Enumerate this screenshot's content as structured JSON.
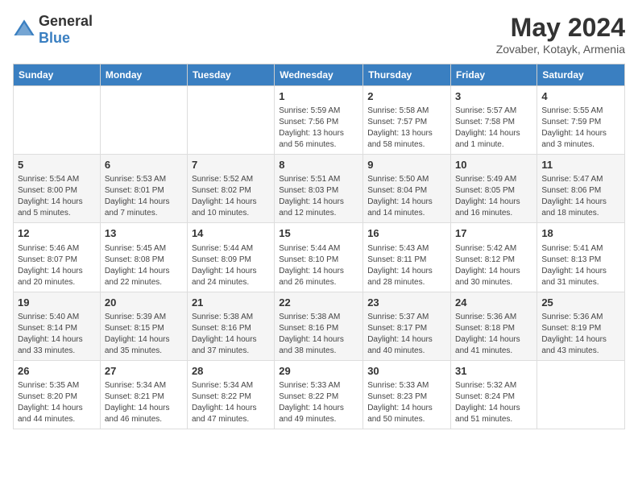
{
  "logo": {
    "general": "General",
    "blue": "Blue"
  },
  "title": {
    "month": "May 2024",
    "location": "Zovaber, Kotayk, Armenia"
  },
  "days_of_week": [
    "Sunday",
    "Monday",
    "Tuesday",
    "Wednesday",
    "Thursday",
    "Friday",
    "Saturday"
  ],
  "weeks": [
    [
      {
        "day": "",
        "info": ""
      },
      {
        "day": "",
        "info": ""
      },
      {
        "day": "",
        "info": ""
      },
      {
        "day": "1",
        "info": "Sunrise: 5:59 AM\nSunset: 7:56 PM\nDaylight: 13 hours and 56 minutes."
      },
      {
        "day": "2",
        "info": "Sunrise: 5:58 AM\nSunset: 7:57 PM\nDaylight: 13 hours and 58 minutes."
      },
      {
        "day": "3",
        "info": "Sunrise: 5:57 AM\nSunset: 7:58 PM\nDaylight: 14 hours and 1 minute."
      },
      {
        "day": "4",
        "info": "Sunrise: 5:55 AM\nSunset: 7:59 PM\nDaylight: 14 hours and 3 minutes."
      }
    ],
    [
      {
        "day": "5",
        "info": "Sunrise: 5:54 AM\nSunset: 8:00 PM\nDaylight: 14 hours and 5 minutes."
      },
      {
        "day": "6",
        "info": "Sunrise: 5:53 AM\nSunset: 8:01 PM\nDaylight: 14 hours and 7 minutes."
      },
      {
        "day": "7",
        "info": "Sunrise: 5:52 AM\nSunset: 8:02 PM\nDaylight: 14 hours and 10 minutes."
      },
      {
        "day": "8",
        "info": "Sunrise: 5:51 AM\nSunset: 8:03 PM\nDaylight: 14 hours and 12 minutes."
      },
      {
        "day": "9",
        "info": "Sunrise: 5:50 AM\nSunset: 8:04 PM\nDaylight: 14 hours and 14 minutes."
      },
      {
        "day": "10",
        "info": "Sunrise: 5:49 AM\nSunset: 8:05 PM\nDaylight: 14 hours and 16 minutes."
      },
      {
        "day": "11",
        "info": "Sunrise: 5:47 AM\nSunset: 8:06 PM\nDaylight: 14 hours and 18 minutes."
      }
    ],
    [
      {
        "day": "12",
        "info": "Sunrise: 5:46 AM\nSunset: 8:07 PM\nDaylight: 14 hours and 20 minutes."
      },
      {
        "day": "13",
        "info": "Sunrise: 5:45 AM\nSunset: 8:08 PM\nDaylight: 14 hours and 22 minutes."
      },
      {
        "day": "14",
        "info": "Sunrise: 5:44 AM\nSunset: 8:09 PM\nDaylight: 14 hours and 24 minutes."
      },
      {
        "day": "15",
        "info": "Sunrise: 5:44 AM\nSunset: 8:10 PM\nDaylight: 14 hours and 26 minutes."
      },
      {
        "day": "16",
        "info": "Sunrise: 5:43 AM\nSunset: 8:11 PM\nDaylight: 14 hours and 28 minutes."
      },
      {
        "day": "17",
        "info": "Sunrise: 5:42 AM\nSunset: 8:12 PM\nDaylight: 14 hours and 30 minutes."
      },
      {
        "day": "18",
        "info": "Sunrise: 5:41 AM\nSunset: 8:13 PM\nDaylight: 14 hours and 31 minutes."
      }
    ],
    [
      {
        "day": "19",
        "info": "Sunrise: 5:40 AM\nSunset: 8:14 PM\nDaylight: 14 hours and 33 minutes."
      },
      {
        "day": "20",
        "info": "Sunrise: 5:39 AM\nSunset: 8:15 PM\nDaylight: 14 hours and 35 minutes."
      },
      {
        "day": "21",
        "info": "Sunrise: 5:38 AM\nSunset: 8:16 PM\nDaylight: 14 hours and 37 minutes."
      },
      {
        "day": "22",
        "info": "Sunrise: 5:38 AM\nSunset: 8:16 PM\nDaylight: 14 hours and 38 minutes."
      },
      {
        "day": "23",
        "info": "Sunrise: 5:37 AM\nSunset: 8:17 PM\nDaylight: 14 hours and 40 minutes."
      },
      {
        "day": "24",
        "info": "Sunrise: 5:36 AM\nSunset: 8:18 PM\nDaylight: 14 hours and 41 minutes."
      },
      {
        "day": "25",
        "info": "Sunrise: 5:36 AM\nSunset: 8:19 PM\nDaylight: 14 hours and 43 minutes."
      }
    ],
    [
      {
        "day": "26",
        "info": "Sunrise: 5:35 AM\nSunset: 8:20 PM\nDaylight: 14 hours and 44 minutes."
      },
      {
        "day": "27",
        "info": "Sunrise: 5:34 AM\nSunset: 8:21 PM\nDaylight: 14 hours and 46 minutes."
      },
      {
        "day": "28",
        "info": "Sunrise: 5:34 AM\nSunset: 8:22 PM\nDaylight: 14 hours and 47 minutes."
      },
      {
        "day": "29",
        "info": "Sunrise: 5:33 AM\nSunset: 8:22 PM\nDaylight: 14 hours and 49 minutes."
      },
      {
        "day": "30",
        "info": "Sunrise: 5:33 AM\nSunset: 8:23 PM\nDaylight: 14 hours and 50 minutes."
      },
      {
        "day": "31",
        "info": "Sunrise: 5:32 AM\nSunset: 8:24 PM\nDaylight: 14 hours and 51 minutes."
      },
      {
        "day": "",
        "info": ""
      }
    ]
  ]
}
